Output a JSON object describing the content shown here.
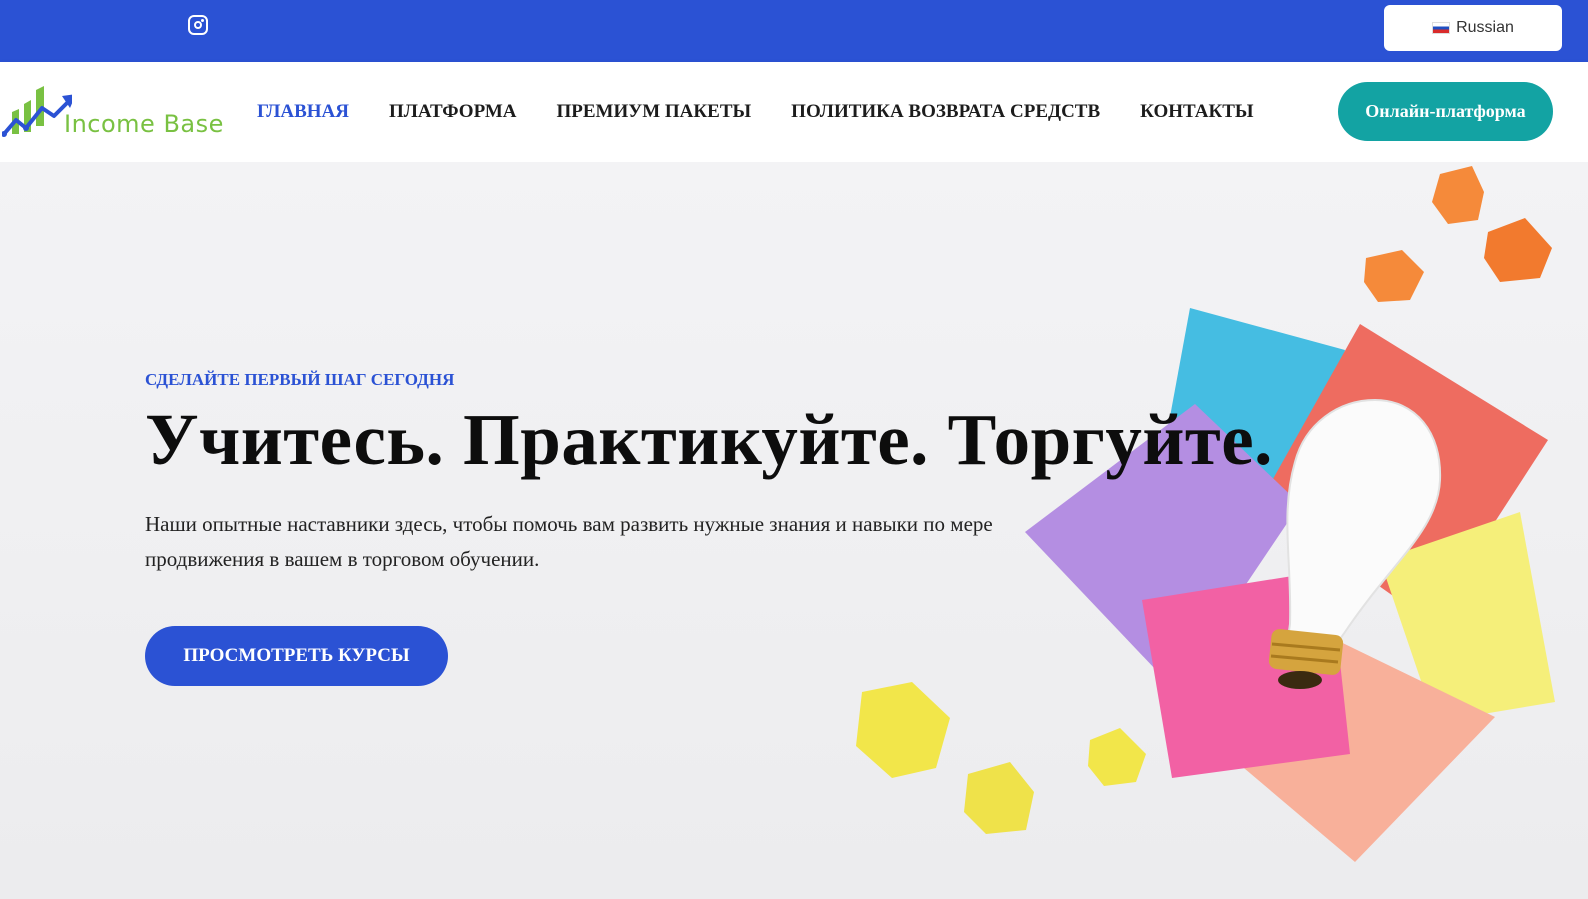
{
  "topbar": {
    "social_icon": "instagram-icon",
    "language": {
      "label": "Russian",
      "flag_icon": "russia-flag-icon"
    }
  },
  "header": {
    "logo_text": "Income Base",
    "nav": [
      {
        "label": "ГЛАВНАЯ",
        "active": true
      },
      {
        "label": "ПЛАТФОРМА",
        "active": false
      },
      {
        "label": "ПРЕМИУМ ПАКЕТЫ",
        "active": false
      },
      {
        "label": "ПОЛИТИКА ВОЗВРАТА СРЕДСТВ",
        "active": false
      },
      {
        "label": "КОНТАКТЫ",
        "active": false
      }
    ],
    "cta_label": "Онлайн-платформа"
  },
  "hero": {
    "kicker": "СДЕЛАЙТЕ ПЕРВЫЙ ШАГ СЕГОДНЯ",
    "headline": "Учитесь. Практикуйте. Торгуйте.",
    "description": "Наши опытные наставники здесь, чтобы помочь вам развить нужные знания и навыки по мере продвижения в вашем в торговом обучении.",
    "button_label": "ПРОСМОТРЕТЬ КУРСЫ"
  },
  "colors": {
    "primary": "#2b52d4",
    "teal": "#13a3a3",
    "logo_green": "#79c142"
  }
}
